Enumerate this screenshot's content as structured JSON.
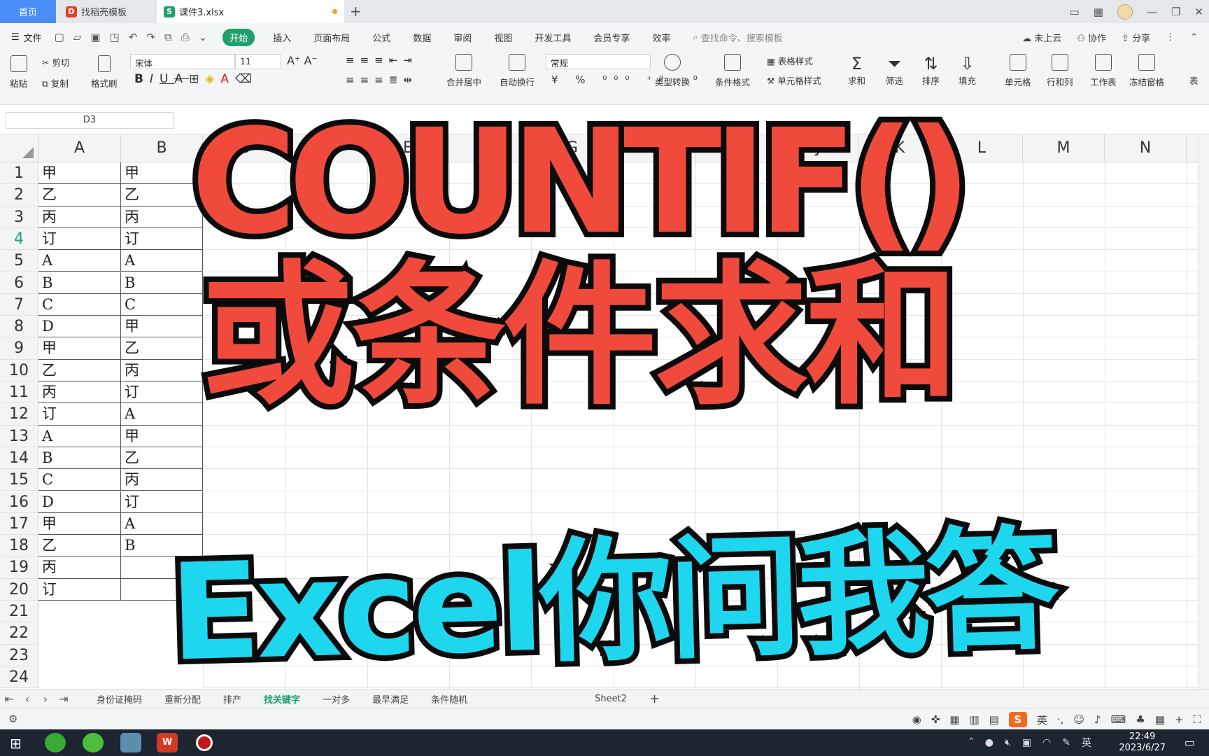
{
  "tabs": {
    "home": "首页",
    "template": "找稻壳模板",
    "file": "课件3.xlsx"
  },
  "menu": {
    "file": "文件",
    "items": [
      "开始",
      "插入",
      "页面布局",
      "公式",
      "数据",
      "审阅",
      "视图",
      "开发工具",
      "会员专享",
      "效率"
    ],
    "search_placeholder": "查找命令、搜索模板",
    "cloud": "未上云",
    "collab": "协作",
    "share": "分享"
  },
  "ribbon": {
    "paste": "粘贴",
    "cut": "剪切",
    "copy": "复制",
    "format_painter": "格式刷",
    "font_name": "宋体",
    "font_size": "11",
    "merge": "合并居中",
    "wrap": "自动换行",
    "number_format": "常规",
    "type_convert": "类型转换",
    "cond_format": "条件格式",
    "table_style": "表格样式",
    "cell_style": "单元格样式",
    "sum": "求和",
    "filter": "筛选",
    "sort": "排序",
    "fill": "填充",
    "cell": "单元格",
    "rowcol": "行和列",
    "sheet": "工作表",
    "freeze": "冻结窗格",
    "table_tools": "表"
  },
  "formula_bar": {
    "name_box": "D3"
  },
  "columns": [
    "A",
    "B",
    "C",
    "D",
    "E",
    "F",
    "G",
    "H",
    "I",
    "J",
    "K",
    "L",
    "M",
    "N"
  ],
  "rows": [
    "1",
    "2",
    "3",
    "4",
    "5",
    "6",
    "7",
    "8",
    "9",
    "10",
    "11",
    "12",
    "13",
    "14",
    "15",
    "16",
    "17",
    "18",
    "19",
    "20",
    "21",
    "22",
    "23",
    "24"
  ],
  "colA": [
    "甲",
    "乙",
    "丙",
    "订",
    "A",
    "B",
    "C",
    "D",
    "甲",
    "乙",
    "丙",
    "订",
    "A",
    "B",
    "C",
    "D",
    "甲",
    "乙",
    "丙",
    "订"
  ],
  "colB": [
    "甲",
    "乙",
    "丙",
    "订",
    "A",
    "B",
    "C",
    "甲",
    "乙",
    "丙",
    "订",
    "A",
    "甲",
    "乙",
    "丙",
    "订",
    "A",
    "B",
    "",
    ""
  ],
  "overlay": {
    "line1": "COUNTIF()",
    "line2": "或条件求和",
    "line3": "Excel你问我答"
  },
  "sheet_tabs": [
    "身份证掩码",
    "重新分配",
    "排产",
    "找关键字",
    "一对多",
    "最早满足",
    "条件随机",
    "",
    "",
    "Sheet2"
  ],
  "active_sheet": "找关键字",
  "ime": {
    "logo": "S",
    "lang": "英"
  },
  "taskbar": {
    "time": "22:49",
    "date": "2023/6/27",
    "lang": "英"
  },
  "colors": {
    "accent": "#1fa06a",
    "home_tab": "#4b8df6",
    "title_red": "#f04a3c",
    "title_cyan": "#1fd6ef"
  }
}
